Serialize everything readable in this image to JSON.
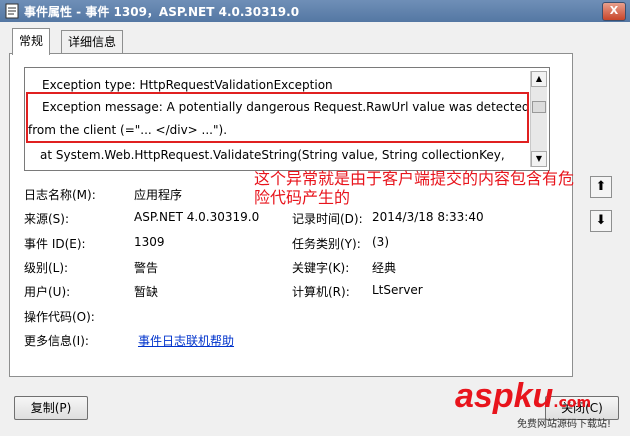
{
  "window": {
    "title": "事件属性 - 事件 1309，ASP.NET 4.0.30319.0",
    "close_glyph": "X"
  },
  "tabs": [
    {
      "label": "常规"
    },
    {
      "label": "详细信息"
    }
  ],
  "message": {
    "line1": "Exception type: HttpRequestValidationException",
    "line2": "Exception message: A potentially dangerous Request.RawUrl value was detected",
    "line3": "from the client (=\"...            </div>                  ...\").",
    "line4": "at System.Web.HttpRequest.ValidateString(String value, String collectionKey,"
  },
  "fields": {
    "log_name": {
      "label": "日志名称(M):",
      "value": "应用程序"
    },
    "source": {
      "label": "来源(S):",
      "value": "ASP.NET 4.0.30319.0"
    },
    "logged": {
      "label": "记录时间(D):",
      "value": "2014/3/18 8:33:40"
    },
    "event_id": {
      "label": "事件 ID(E):",
      "value": "1309"
    },
    "task": {
      "label": "任务类别(Y):",
      "value": "(3)"
    },
    "level": {
      "label": "级别(L):",
      "value": "警告"
    },
    "keywords": {
      "label": "关键字(K):",
      "value": "经典"
    },
    "user": {
      "label": "用户(U):",
      "value": "暂缺"
    },
    "computer": {
      "label": "计算机(R):",
      "value": "LtServer"
    },
    "opcode": {
      "label": "操作代码(O):",
      "value": ""
    },
    "more_info": {
      "label": "更多信息(I):",
      "link": "事件日志联机帮助"
    }
  },
  "annotation": "这个异常就是由于客户端提交的内容包含有危险代码产生的",
  "buttons": {
    "copy": "复制(P)",
    "close": "关闭(C)"
  },
  "watermark": {
    "brand": "aspku",
    "brand_suffix": ".com",
    "tagline": "免费网站源码下载站!"
  },
  "colors": {
    "annotation_red": "#e8141c",
    "link_blue": "#0033cc",
    "title_bar": "#5477a3"
  }
}
